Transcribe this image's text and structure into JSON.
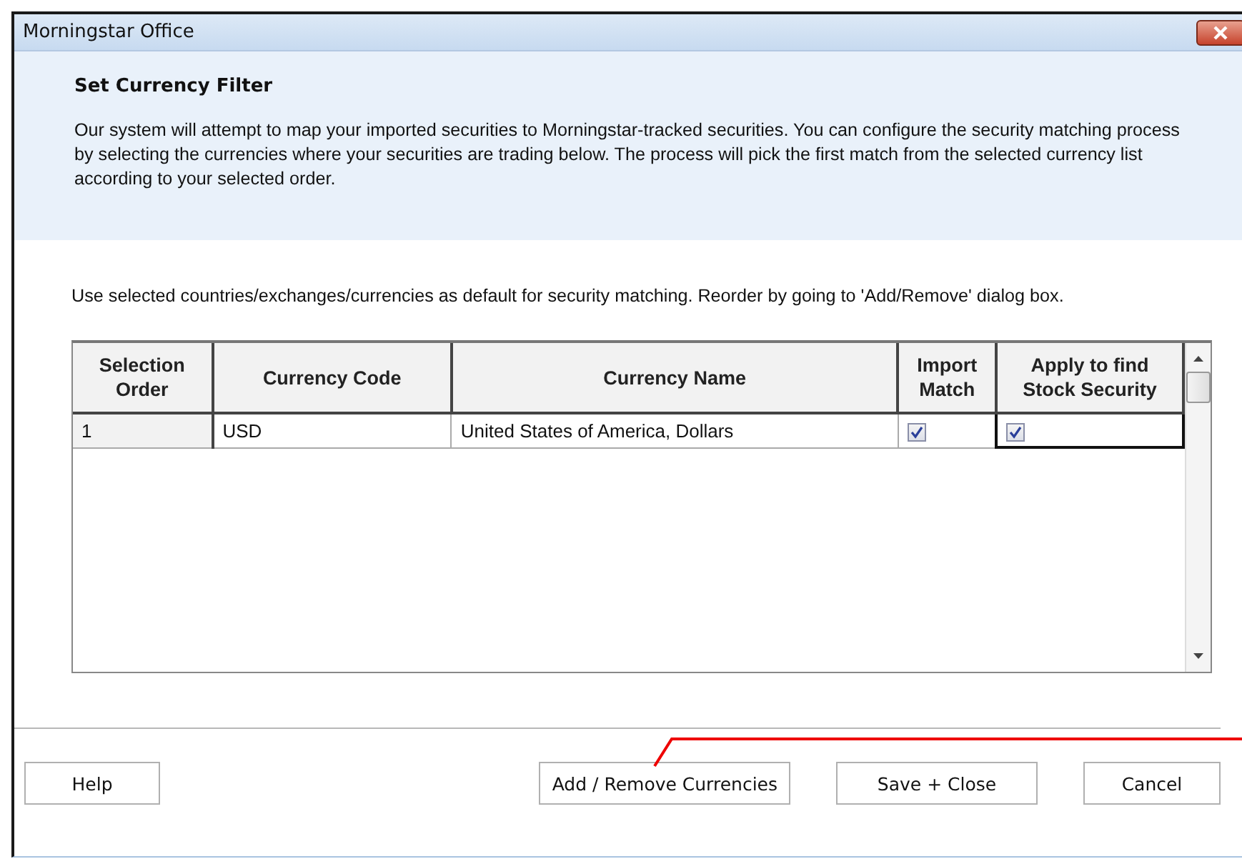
{
  "window": {
    "title": "Morningstar Office"
  },
  "header": {
    "title": "Set Currency Filter",
    "description": "Our system will attempt to map your imported securities to Morningstar-tracked securities.  You can configure the security matching process by selecting the currencies where your securities are trading below.  The process will pick the first match from the selected currency list according to your selected order."
  },
  "note": "Use selected countries/exchanges/currencies as default for security matching. Reorder by going to 'Add/Remove' dialog box.",
  "table": {
    "columns": [
      "Selection Order",
      "Currency Code",
      "Currency Name",
      "Import Match",
      "Apply to find Stock Security"
    ],
    "rows": [
      {
        "selection_order": "1",
        "currency_code": "USD",
        "currency_name": "United States of America, Dollars",
        "import_match": true,
        "apply_to_find": true,
        "current": true
      }
    ]
  },
  "buttons": [
    {
      "label": "Help",
      "kind": "left"
    },
    {
      "label": "Add / Remove Currencies",
      "kind": "right"
    },
    {
      "label": "Save + Close",
      "kind": "right"
    },
    {
      "label": "Cancel",
      "kind": "right"
    }
  ]
}
